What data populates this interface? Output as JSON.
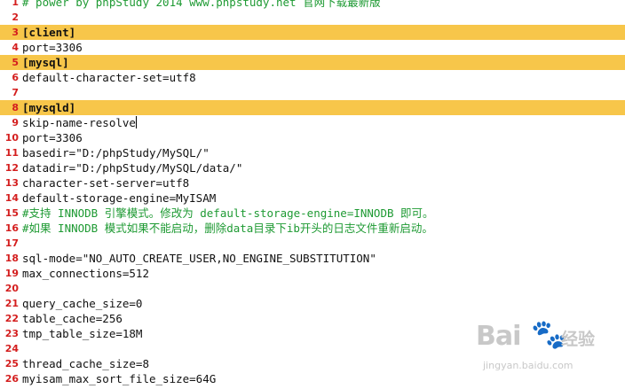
{
  "editor": {
    "lines": [
      {
        "num": "1",
        "text": "# power by phpStudy 2014 www.phpstudy.net 官网下载最新版",
        "kind": "comment"
      },
      {
        "num": "2",
        "text": "",
        "kind": "plain"
      },
      {
        "num": "3",
        "text": "[client]",
        "kind": "section"
      },
      {
        "num": "4",
        "text": "port=3306",
        "kind": "plain"
      },
      {
        "num": "5",
        "text": "[mysql]",
        "kind": "section"
      },
      {
        "num": "6",
        "text": "default-character-set=utf8",
        "kind": "plain"
      },
      {
        "num": "7",
        "text": "",
        "kind": "plain"
      },
      {
        "num": "8",
        "text": "[mysqld]",
        "kind": "section"
      },
      {
        "num": "9",
        "text": "skip-name-resolve",
        "kind": "plain"
      },
      {
        "num": "10",
        "text": "port=3306",
        "kind": "plain"
      },
      {
        "num": "11",
        "text": "basedir=\"D:/phpStudy/MySQL/\"",
        "kind": "plain"
      },
      {
        "num": "12",
        "text": "datadir=\"D:/phpStudy/MySQL/data/\"",
        "kind": "plain"
      },
      {
        "num": "13",
        "text": "character-set-server=utf8",
        "kind": "plain"
      },
      {
        "num": "14",
        "text": "default-storage-engine=MyISAM",
        "kind": "plain"
      },
      {
        "num": "15",
        "text": "#支持 INNODB 引擎模式。修改为 default-storage-engine=INNODB 即可。",
        "kind": "comment"
      },
      {
        "num": "16",
        "text": "#如果 INNODB 模式如果不能启动，删除data目录下ib开头的日志文件重新启动。",
        "kind": "comment"
      },
      {
        "num": "17",
        "text": "",
        "kind": "plain"
      },
      {
        "num": "18",
        "text": "sql-mode=\"NO_AUTO_CREATE_USER,NO_ENGINE_SUBSTITUTION\"",
        "kind": "plain"
      },
      {
        "num": "19",
        "text": "max_connections=512",
        "kind": "plain"
      },
      {
        "num": "20",
        "text": "",
        "kind": "plain"
      },
      {
        "num": "21",
        "text": "query_cache_size=0",
        "kind": "plain"
      },
      {
        "num": "22",
        "text": "table_cache=256",
        "kind": "plain"
      },
      {
        "num": "23",
        "text": "tmp_table_size=18M",
        "kind": "plain"
      },
      {
        "num": "24",
        "text": "",
        "kind": "plain"
      },
      {
        "num": "25",
        "text": "thread_cache_size=8",
        "kind": "plain"
      },
      {
        "num": "26",
        "text": "myisam_max_sort_file_size=64G",
        "kind": "plain"
      }
    ],
    "caret_line": "9",
    "colors": {
      "section_highlight": "#f7c64a",
      "line_number": "#d41e1e",
      "comment": "#1e9a33",
      "text": "#111111"
    }
  },
  "watermark": {
    "logo_text": "Bai",
    "logo_suffix": "经验",
    "domain": "jingyan.baidu.com",
    "icon": "baidu-paw-icon"
  }
}
